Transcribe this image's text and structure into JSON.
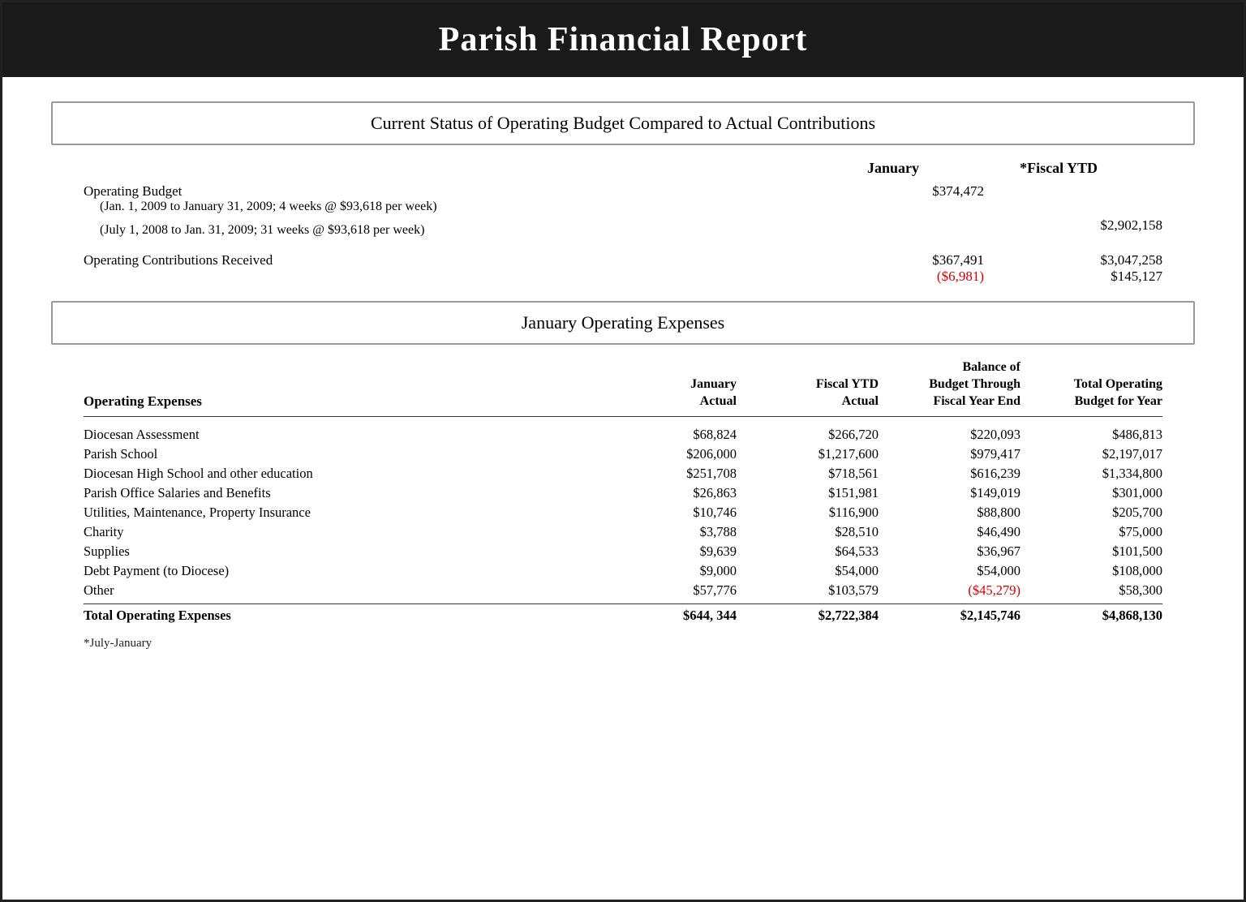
{
  "header": {
    "title": "Parish Financial Report"
  },
  "section1": {
    "title": "Current Status of Operating Budget Compared to Actual Contributions",
    "columns": {
      "col1": "January",
      "col2": "*Fiscal YTD"
    },
    "operating_budget": {
      "label": "Operating Budget",
      "sub1_label": "(Jan. 1, 2009 to January 31, 2009; 4 weeks @ $93,618 per week)",
      "sub1_jan": "$374,472",
      "sub1_ytd": "",
      "sub2_label": "(July 1, 2008 to Jan. 31, 2009; 31 weeks @ $93,618 per week)",
      "sub2_jan": "",
      "sub2_ytd": "$2,902,158"
    },
    "contributions": {
      "label": "Operating Contributions Received",
      "jan_val1": "$367,491",
      "jan_val2": "($6,981)",
      "ytd_val1": "$3,047,258",
      "ytd_val2": "$145,127"
    }
  },
  "section2": {
    "title": "January Operating Expenses",
    "col_headers": {
      "name": "Operating Expenses",
      "jan_actual": "January\nActual",
      "fiscal_ytd": "Fiscal YTD\nActual",
      "balance": "Balance of\nBudget Through\nFiscal Year End",
      "total_budget": "Total Operating\nBudget for Year"
    },
    "rows": [
      {
        "name": "Diocesan Assessment",
        "jan_actual": "$68,824",
        "fiscal_ytd": "$266,720",
        "balance": "$220,093",
        "total_budget": "$486,813",
        "balance_negative": false
      },
      {
        "name": "Parish School",
        "jan_actual": "$206,000",
        "fiscal_ytd": "$1,217,600",
        "balance": "$979,417",
        "total_budget": "$2,197,017",
        "balance_negative": false
      },
      {
        "name": "Diocesan High School and other education",
        "jan_actual": "$251,708",
        "fiscal_ytd": "$718,561",
        "balance": "$616,239",
        "total_budget": "$1,334,800",
        "balance_negative": false
      },
      {
        "name": "Parish Office Salaries and Benefits",
        "jan_actual": "$26,863",
        "fiscal_ytd": "$151,981",
        "balance": "$149,019",
        "total_budget": "$301,000",
        "balance_negative": false
      },
      {
        "name": "Utilities, Maintenance, Property Insurance",
        "jan_actual": "$10,746",
        "fiscal_ytd": "$116,900",
        "balance": "$88,800",
        "total_budget": "$205,700",
        "balance_negative": false
      },
      {
        "name": "Charity",
        "jan_actual": "$3,788",
        "fiscal_ytd": "$28,510",
        "balance": "$46,490",
        "total_budget": "$75,000",
        "balance_negative": false
      },
      {
        "name": "Supplies",
        "jan_actual": "$9,639",
        "fiscal_ytd": "$64,533",
        "balance": "$36,967",
        "total_budget": "$101,500",
        "balance_negative": false
      },
      {
        "name": "Debt Payment (to Diocese)",
        "jan_actual": "$9,000",
        "fiscal_ytd": "$54,000",
        "balance": "$54,000",
        "total_budget": "$108,000",
        "balance_negative": false
      },
      {
        "name": "Other",
        "jan_actual": "$57,776",
        "fiscal_ytd": "$103,579",
        "balance": "($45,279)",
        "total_budget": "$58,300",
        "balance_negative": true
      }
    ],
    "totals": {
      "name": "Total Operating Expenses",
      "jan_actual": "$644, 344",
      "fiscal_ytd": "$2,722,384",
      "balance": "$2,145,746",
      "total_budget": "$4,868,130"
    },
    "footnote": "*July-January"
  }
}
